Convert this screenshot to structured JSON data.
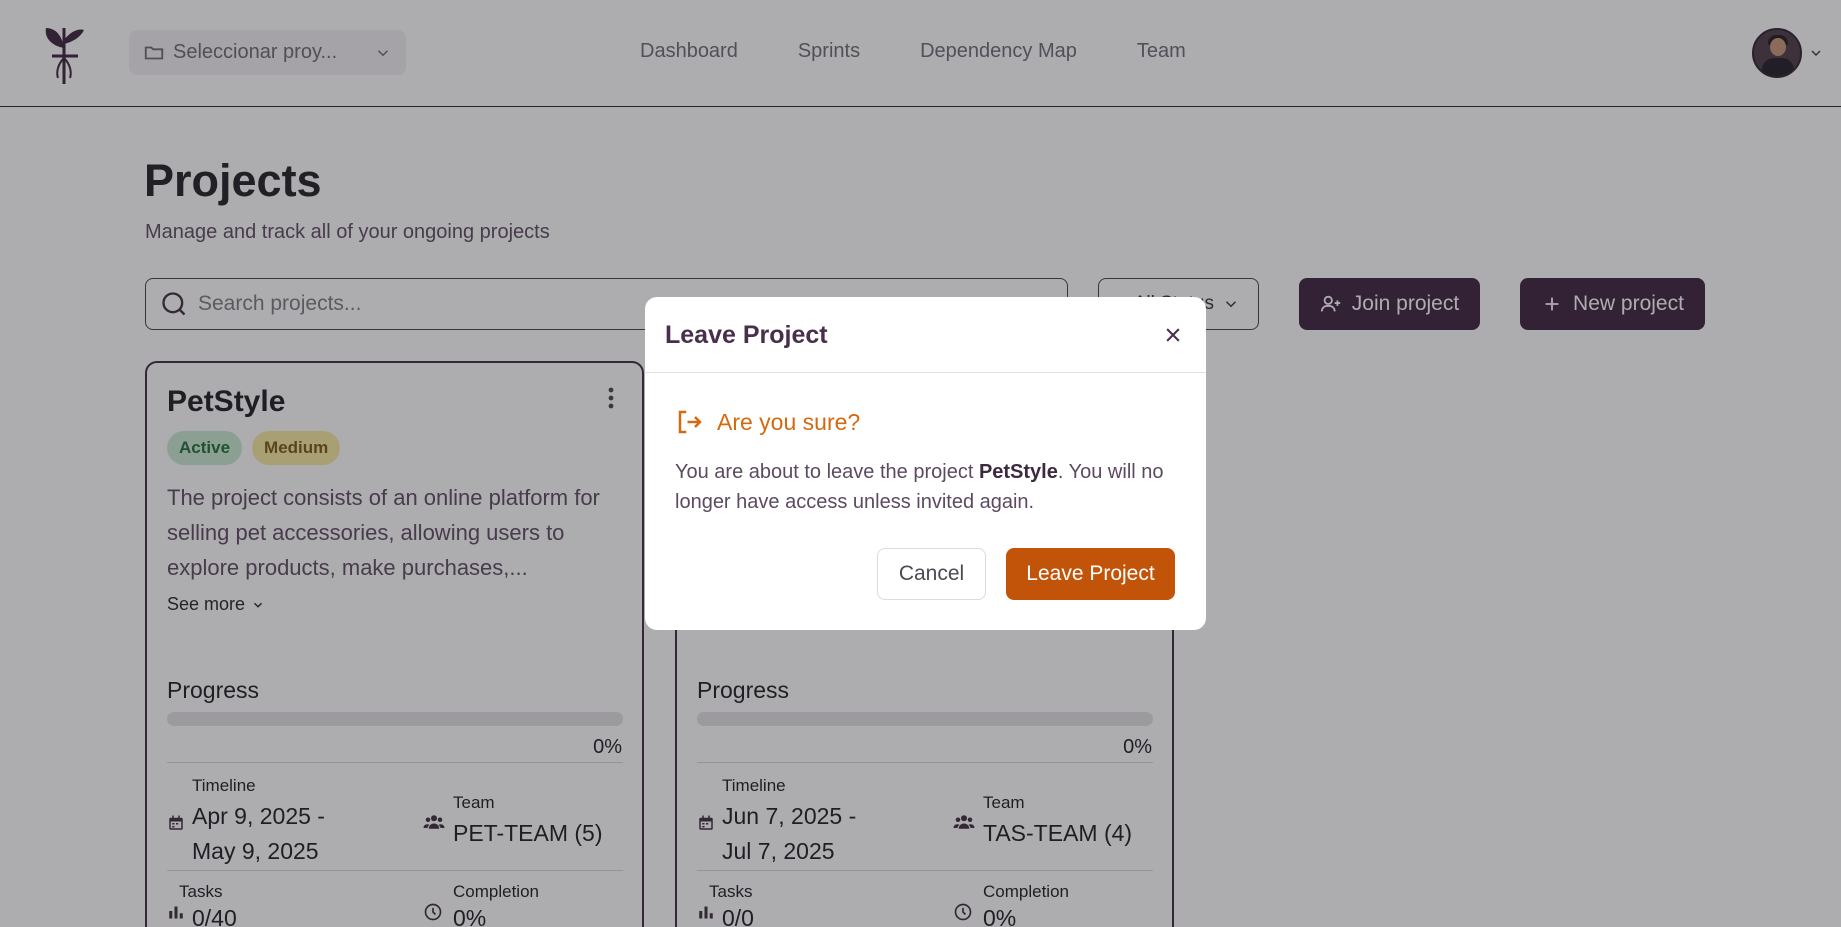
{
  "header": {
    "project_selector": "Seleccionar proy...",
    "nav": [
      "Dashboard",
      "Sprints",
      "Dependency Map",
      "Team"
    ]
  },
  "page": {
    "title": "Projects",
    "subtitle": "Manage and track all of your ongoing projects",
    "search_placeholder": "Search projects...",
    "filter_label": "All Status",
    "join_label": "Join project",
    "new_label": "New project"
  },
  "cards": [
    {
      "name": "PetStyle",
      "status": "Active",
      "priority": "Medium",
      "description": "The project consists of an online platform for selling pet accessories, allowing users to explore products, make purchases,...",
      "see_more": "See more",
      "progress_label": "Progress",
      "progress": 0,
      "progress_text": "0%",
      "timeline_label": "Timeline",
      "timeline_start": "Apr 9, 2025 -",
      "timeline_end": "May 9, 2025",
      "team_label": "Team",
      "team_value": "PET-TEAM (5)",
      "tasks_label": "Tasks",
      "tasks_value": "0/40",
      "completion_label": "Completion",
      "completion_value": "0%"
    },
    {
      "progress_label": "Progress",
      "progress": 0,
      "progress_text": "0%",
      "timeline_label": "Timeline",
      "timeline_start": "Jun 7, 2025 -",
      "timeline_end": "Jul 7, 2025",
      "team_label": "Team",
      "team_value": "TAS-TEAM (4)",
      "tasks_label": "Tasks",
      "tasks_value": "0/0",
      "completion_label": "Completion",
      "completion_value": "0%"
    }
  ],
  "modal": {
    "title": "Leave Project",
    "warning": "Are you sure?",
    "body_prefix": "You are about to leave the project ",
    "body_project": "PetStyle",
    "body_suffix": ". You will no longer have access unless invited again.",
    "cancel_label": "Cancel",
    "confirm_label": "Leave Project"
  },
  "colors": {
    "brand": "#3a1f3c",
    "warning": "#d46a10",
    "danger_button": "#c25409"
  }
}
